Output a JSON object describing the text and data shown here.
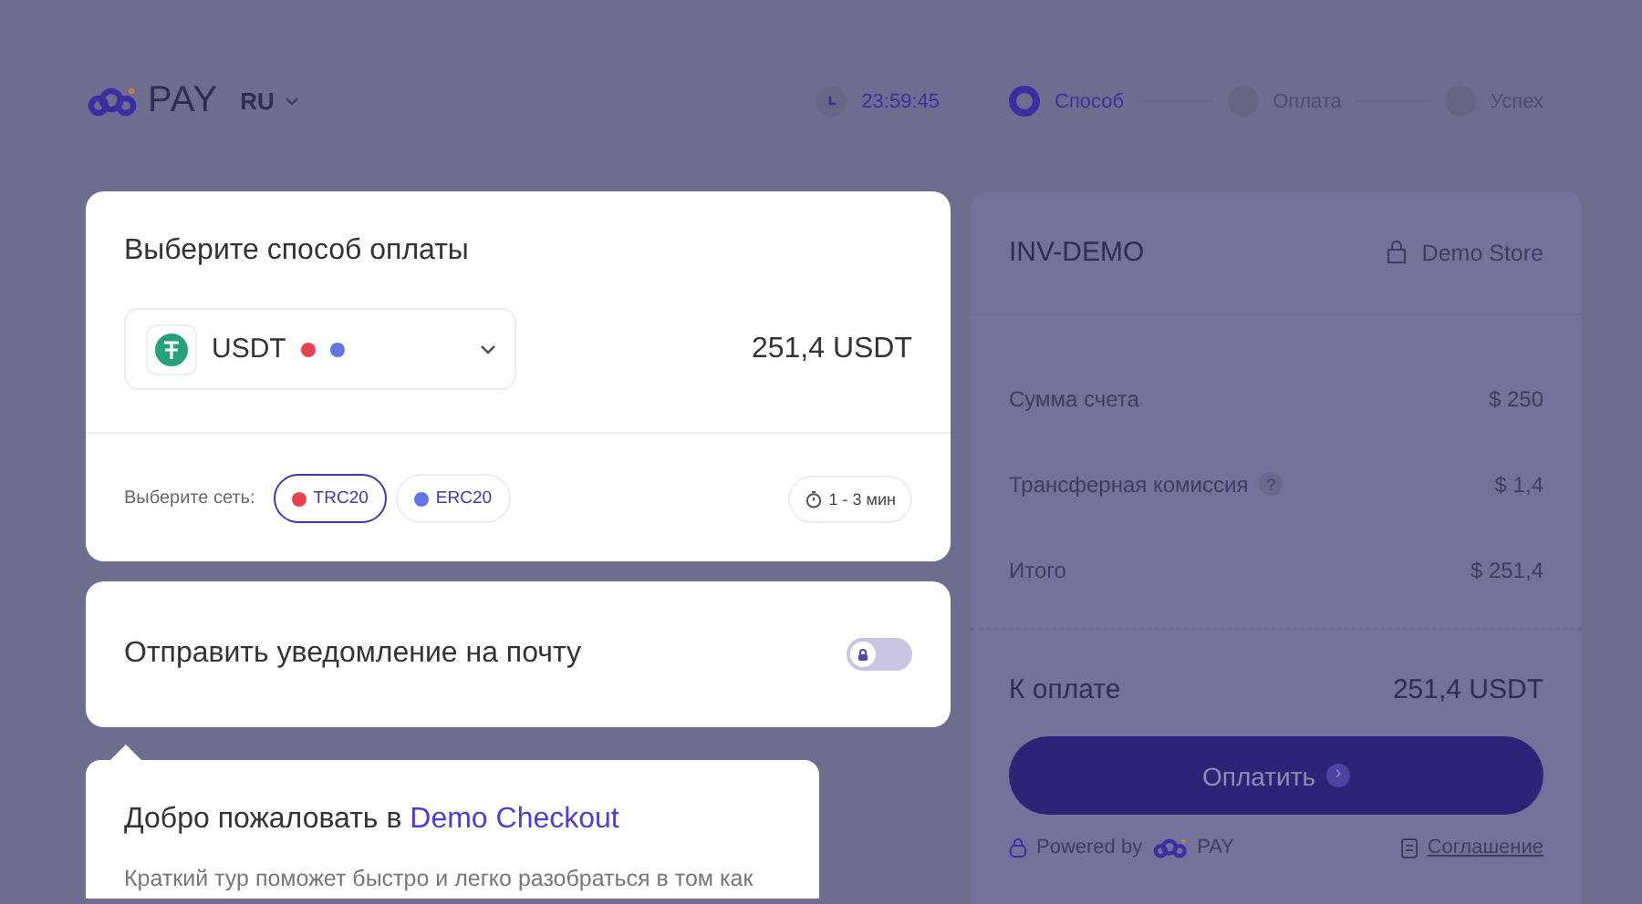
{
  "header": {
    "logo_text": "PAY",
    "language": "RU",
    "timer": "23:59:45"
  },
  "steps": [
    {
      "label": "Способ",
      "selected": true
    },
    {
      "label": "Оплата",
      "selected": false
    },
    {
      "label": "Успех",
      "selected": false
    }
  ],
  "payment_card": {
    "title": "Выберите способ оплаты",
    "currency": "USDT",
    "amount": "251,4 USDT",
    "network_label": "Выберите сеть:",
    "networks": [
      {
        "label": "TRC20",
        "selected": true,
        "color": "#e8424f"
      },
      {
        "label": "ERC20",
        "selected": false,
        "color": "#6274e8"
      }
    ],
    "eta": "1 - 3 мин"
  },
  "notification": {
    "label": "Отправить уведомление на почту",
    "on": false
  },
  "tour": {
    "title": "Добро пожаловать в",
    "title_highlight": "Demo Checkout",
    "text": "Краткий тур поможет быстро и легко разобраться в том как"
  },
  "invoice": {
    "id": "INV-DEMO",
    "store": "Demo Store",
    "rows": [
      {
        "label": "Сумма счета",
        "value": "$ 250"
      },
      {
        "label": "Трансферная комиссия",
        "hint": "?",
        "value": "$ 1,4"
      },
      {
        "label": "Итого",
        "value": "$ 251,4"
      }
    ],
    "total_label": "К оплате",
    "total_value": "251,4 USDT",
    "pay_button": "Оплатить",
    "pay_arrow": "›",
    "powered_by": "Powered by",
    "powered_logo": "PAY",
    "agreement": "Соглашение"
  }
}
